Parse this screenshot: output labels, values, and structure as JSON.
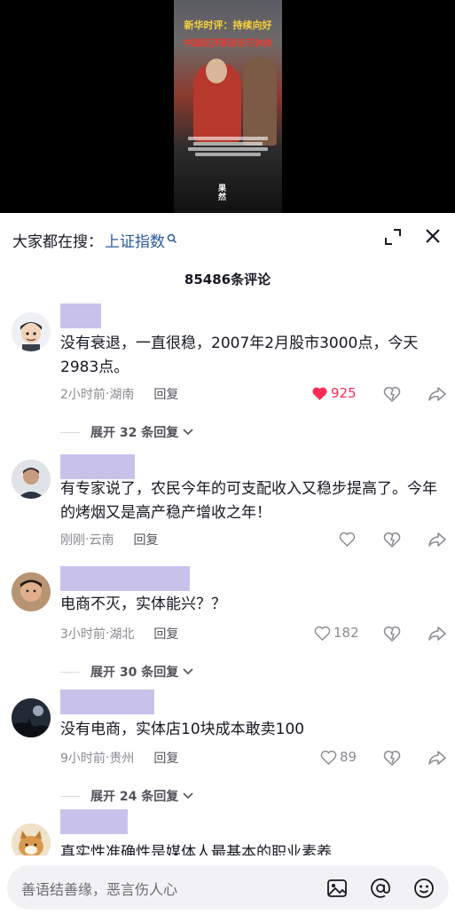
{
  "video": {
    "title_line1": "新华时评：持续向好",
    "title_line2": "中国经济衰退论可休矣",
    "watermark": "果然"
  },
  "search": {
    "prefix": "大家都在搜：",
    "term": "上证指数"
  },
  "comment_count": "85486条评论",
  "comments": [
    {
      "text": "没有衰退，一直很稳，2007年2月股市3000点，今天2983点。",
      "time": "2小时前",
      "location": "湖南",
      "reply": "回复",
      "likes": "925",
      "liked": true,
      "expand": "展开 32 条回复"
    },
    {
      "text": "有专家说了，农民今年的可支配收入又稳步提高了。今年的烤烟又是高产稳产增收之年！",
      "time": "刚刚",
      "location": "云南",
      "reply": "回复",
      "likes": ""
    },
    {
      "text": "电商不灭，实体能兴？？",
      "time": "3小时前",
      "location": "湖北",
      "reply": "回复",
      "likes": "182",
      "expand": "展开 30 条回复"
    },
    {
      "text": "没有电商，实体店10块成本敢卖100",
      "time": "9小时前",
      "location": "贵州",
      "reply": "回复",
      "likes": "89",
      "expand": "展开 24 条回复"
    },
    {
      "text": "真实性准确性是媒体人最基本的职业素养"
    }
  ],
  "input": {
    "placeholder": "善语结善缘，恶言伤人心"
  },
  "colors": {
    "accent_link": "#2b5a9e",
    "like_red": "#fe2c55",
    "name_block": "#c8c2eb"
  }
}
